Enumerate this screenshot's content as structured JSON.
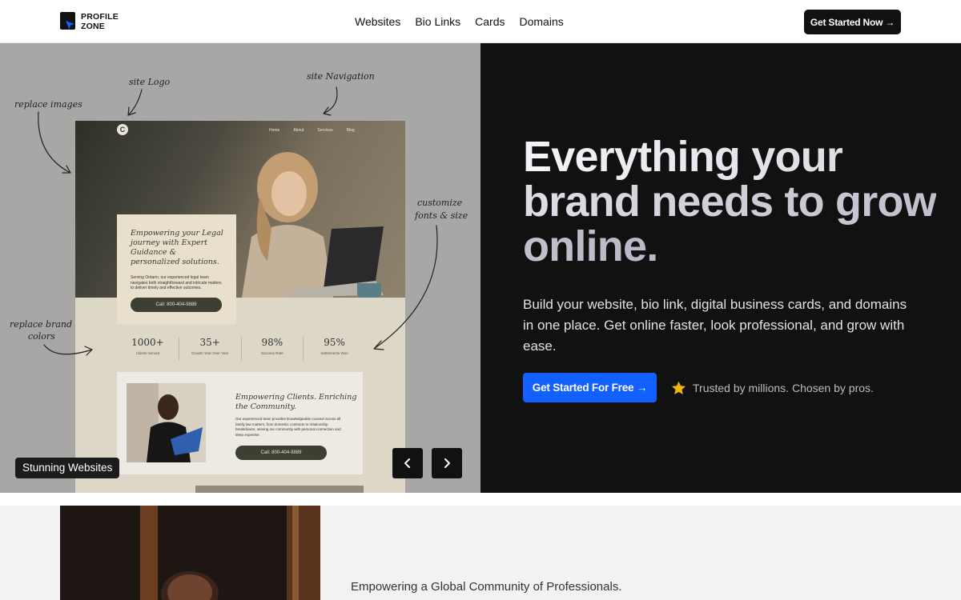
{
  "header": {
    "logo_line1": "PROFILE",
    "logo_line2": "ZONE",
    "nav": [
      "Websites",
      "Bio Links",
      "Cards",
      "Domains"
    ],
    "cta_label": "Get Started Now →"
  },
  "hero_left": {
    "annotations": {
      "site_logo": "site Logo",
      "site_navigation": "site Navigation",
      "replace_images": "replace images",
      "customize_fonts_1": "customize",
      "customize_fonts_2": "fonts & size",
      "replace_brand_1": "replace brand",
      "replace_brand_2": "colors"
    },
    "mock": {
      "logo_letter": "C",
      "nav": [
        "Home",
        "About",
        "Services",
        "Blog"
      ],
      "card_heading": "Empowering your Legal journey with Expert Guidance & personalized solutions.",
      "card_text": "Serving Ontario, our experienced legal team navigates both straightforward and intricate matters to deliver timely and effective outcomes.",
      "card_button": "Call: 800-404-9889",
      "stats": [
        {
          "number": "1000+",
          "label": "Clients Served"
        },
        {
          "number": "35+",
          "label": "Growth Year Over Year"
        },
        {
          "number": "98%",
          "label": "Success Rate"
        },
        {
          "number": "95%",
          "label": "Settlements Won"
        }
      ],
      "card2_heading": "Empowering Clients. Enriching the Community.",
      "card2_text": "Our experienced team provides knowledgeable counsel across all family law matters, from domestic contracts to relationship breakdowns, serving our community with personal connection and deep expertise.",
      "card2_button": "Call: 800-404-9889"
    },
    "chip_label": "Stunning Websites",
    "prev_icon": "chevron-left-icon",
    "next_icon": "chevron-right-icon"
  },
  "hero_right": {
    "headline": "Everything your brand needs to grow online.",
    "subtext": "Build your website, bio link, digital business cards, and domains in one place. Get online faster, look professional, and grow with ease.",
    "cta_label": "Get Started For Free →",
    "trust_text": "Trusted by millions. Chosen by pros.",
    "trust_icon": "star-icon"
  },
  "lower": {
    "tagline": "Empowering a Global Community of Professionals."
  },
  "colors": {
    "accent": "#1160ff",
    "dark": "#111111",
    "star": "#f2b705"
  }
}
